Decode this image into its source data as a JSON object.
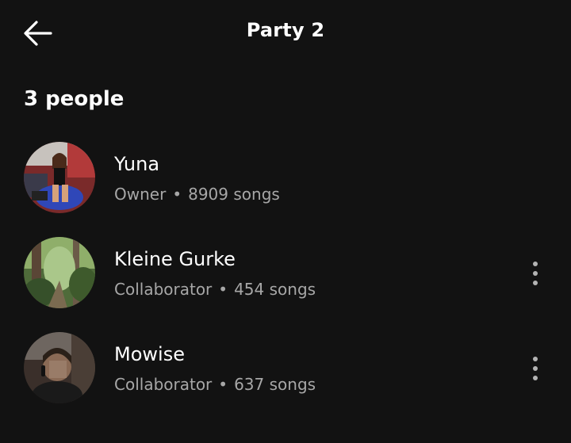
{
  "header": {
    "back_icon": "arrow-left-icon",
    "title": "Party 2"
  },
  "section": {
    "heading": "3 people"
  },
  "people": [
    {
      "name": "Yuna",
      "role": "Owner",
      "separator": "•",
      "songs": "8909 songs",
      "has_menu": false
    },
    {
      "name": "Kleine Gurke",
      "role": "Collaborator",
      "separator": "•",
      "songs": "454 songs",
      "has_menu": true,
      "menu_icon": "more-vertical-icon"
    },
    {
      "name": "Mowise",
      "role": "Collaborator",
      "separator": "•",
      "songs": "637 songs",
      "has_menu": true,
      "menu_icon": "more-vertical-icon"
    }
  ],
  "colors": {
    "background": "#121212",
    "primary_text": "#ffffff",
    "secondary_text": "#a7a7a7"
  }
}
